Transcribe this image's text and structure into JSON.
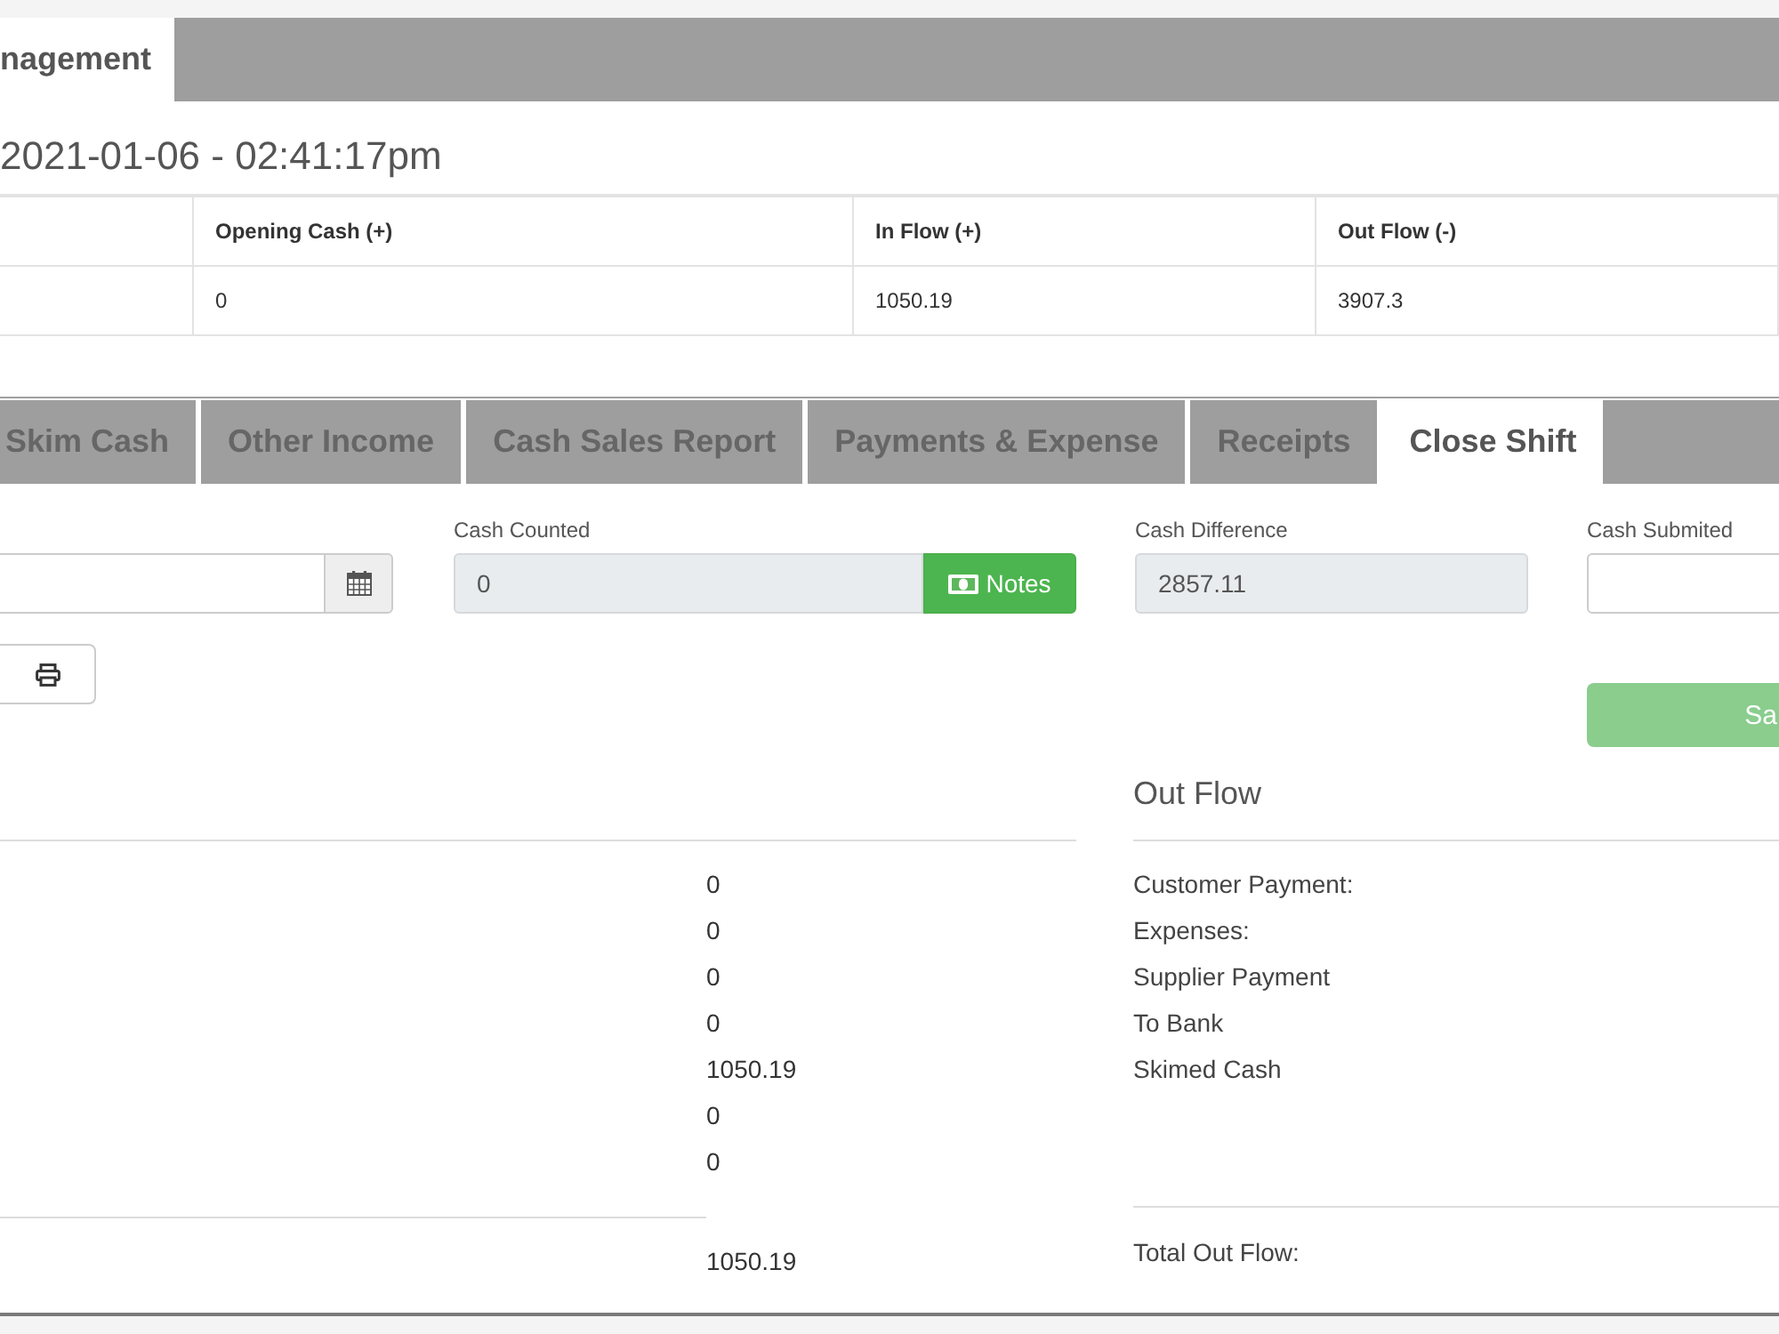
{
  "top_tabs": [
    {
      "label": "nagement",
      "selected": true
    }
  ],
  "timestamp": "2021-01-06 - 02:41:17pm",
  "summary_table": {
    "columns": [
      {
        "label": "Opening Cash (+)"
      },
      {
        "label": "In Flow (+)"
      },
      {
        "label": "Out Flow (-)"
      }
    ],
    "rows": [
      {
        "cells": [
          "0",
          "1050.19",
          "3907.3"
        ]
      }
    ]
  },
  "section_tabs": [
    {
      "label": "Skim Cash",
      "selected": false
    },
    {
      "label": "Other Income",
      "selected": false
    },
    {
      "label": "Cash Sales Report",
      "selected": false
    },
    {
      "label": "Payments & Expense",
      "selected": false
    },
    {
      "label": "Receipts",
      "selected": false
    },
    {
      "label": "Close Shift",
      "selected": true
    }
  ],
  "close_shift": {
    "fields": [
      {
        "kind": "date"
      },
      {
        "kind": "counted",
        "label": "Cash Counted",
        "value": "0",
        "button": "Notes"
      },
      {
        "kind": "readonly",
        "label": "Cash Difference",
        "value": "2857.11"
      },
      {
        "kind": "input",
        "label": "Cash Submited"
      }
    ],
    "save_button": {
      "label": "Sa",
      "disabled": true
    }
  },
  "in_flow": {
    "rows": [
      {
        "value": "0"
      },
      {
        "value": "0"
      },
      {
        "value": "0"
      },
      {
        "value": "0"
      },
      {
        "value": "1050.19"
      },
      {
        "value": "0"
      },
      {
        "value": "0"
      }
    ],
    "total": "1050.19"
  },
  "out_flow": {
    "title": "Out Flow",
    "rows": [
      {
        "label": "Customer Payment:"
      },
      {
        "label": "Expenses:"
      },
      {
        "label": "Supplier Payment"
      },
      {
        "label": "To Bank"
      },
      {
        "label": "Skimed Cash"
      }
    ],
    "total_label": "Total Out Flow:"
  }
}
